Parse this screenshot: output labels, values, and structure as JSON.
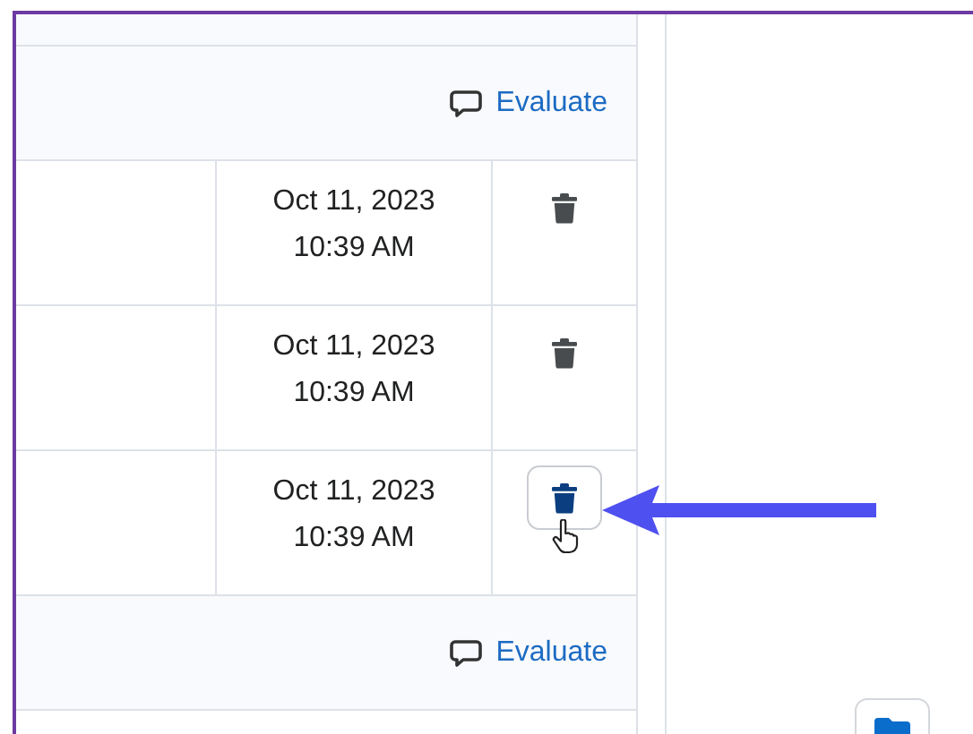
{
  "rows": [
    {
      "kind": "evaluate",
      "label": "Evaluate"
    },
    {
      "kind": "submission",
      "date": "Oct 11, 2023",
      "time": "10:39 AM",
      "focused": false
    },
    {
      "kind": "submission",
      "date": "Oct 11, 2023",
      "time": "10:39 AM",
      "focused": false
    },
    {
      "kind": "submission",
      "date": "Oct 11, 2023",
      "time": "10:39 AM",
      "focused": true
    },
    {
      "kind": "evaluate",
      "label": "Evaluate"
    }
  ]
}
